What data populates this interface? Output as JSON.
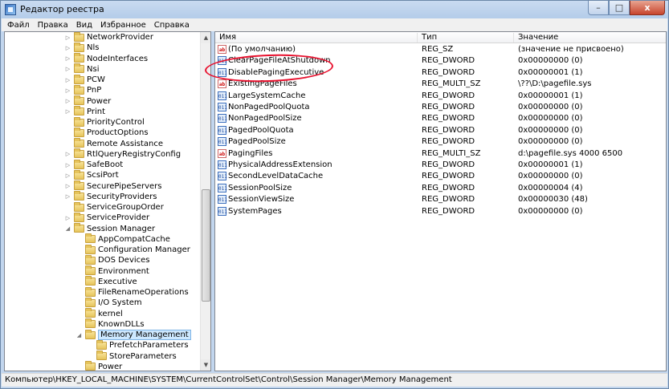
{
  "window": {
    "title": "Редактор реестра",
    "buttons": {
      "minimize": "–",
      "maximize": "□",
      "close": "x"
    }
  },
  "menu": [
    "Файл",
    "Правка",
    "Вид",
    "Избранное",
    "Справка"
  ],
  "tree": {
    "items": [
      {
        "label": "NetworkProvider",
        "level": 1,
        "expander": "▷"
      },
      {
        "label": "Nls",
        "level": 1,
        "expander": "▷"
      },
      {
        "label": "NodeInterfaces",
        "level": 1,
        "expander": "▷"
      },
      {
        "label": "Nsi",
        "level": 1,
        "expander": "▷"
      },
      {
        "label": "PCW",
        "level": 1,
        "expander": "▷"
      },
      {
        "label": "PnP",
        "level": 1,
        "expander": "▷"
      },
      {
        "label": "Power",
        "level": 1,
        "expander": "▷"
      },
      {
        "label": "Print",
        "level": 1,
        "expander": "▷"
      },
      {
        "label": "PriorityControl",
        "level": 1,
        "expander": ""
      },
      {
        "label": "ProductOptions",
        "level": 1,
        "expander": ""
      },
      {
        "label": "Remote Assistance",
        "level": 1,
        "expander": ""
      },
      {
        "label": "RtlQueryRegistryConfig",
        "level": 1,
        "expander": "▷"
      },
      {
        "label": "SafeBoot",
        "level": 1,
        "expander": "▷"
      },
      {
        "label": "ScsiPort",
        "level": 1,
        "expander": "▷"
      },
      {
        "label": "SecurePipeServers",
        "level": 1,
        "expander": "▷"
      },
      {
        "label": "SecurityProviders",
        "level": 1,
        "expander": "▷"
      },
      {
        "label": "ServiceGroupOrder",
        "level": 1,
        "expander": ""
      },
      {
        "label": "ServiceProvider",
        "level": 1,
        "expander": "▷"
      },
      {
        "label": "Session Manager",
        "level": 1,
        "expander": "◢"
      },
      {
        "label": "AppCompatCache",
        "level": 2,
        "expander": ""
      },
      {
        "label": "Configuration Manager",
        "level": 2,
        "expander": ""
      },
      {
        "label": "DOS Devices",
        "level": 2,
        "expander": ""
      },
      {
        "label": "Environment",
        "level": 2,
        "expander": ""
      },
      {
        "label": "Executive",
        "level": 2,
        "expander": ""
      },
      {
        "label": "FileRenameOperations",
        "level": 2,
        "expander": ""
      },
      {
        "label": "I/O System",
        "level": 2,
        "expander": ""
      },
      {
        "label": "kernel",
        "level": 2,
        "expander": ""
      },
      {
        "label": "KnownDLLs",
        "level": 2,
        "expander": ""
      },
      {
        "label": "Memory Management",
        "level": 2,
        "expander": "◢",
        "selected": true
      },
      {
        "label": "PrefetchParameters",
        "level": 3,
        "expander": ""
      },
      {
        "label": "StoreParameters",
        "level": 3,
        "expander": ""
      },
      {
        "label": "Power",
        "level": 2,
        "expander": ""
      }
    ]
  },
  "list": {
    "columns": [
      "Имя",
      "Тип",
      "Значение"
    ],
    "rows": [
      {
        "name": "(По умолчанию)",
        "type": "REG_SZ",
        "value": "(значение не присвоено)",
        "icon": "sz"
      },
      {
        "name": "ClearPageFileAtShutdown",
        "type": "REG_DWORD",
        "value": "0x00000000 (0)",
        "icon": "dword"
      },
      {
        "name": "DisablePagingExecutive",
        "type": "REG_DWORD",
        "value": "0x00000001 (1)",
        "icon": "dword"
      },
      {
        "name": "ExistingPageFiles",
        "type": "REG_MULTI_SZ",
        "value": "\\??\\D:\\pagefile.sys",
        "icon": "sz"
      },
      {
        "name": "LargeSystemCache",
        "type": "REG_DWORD",
        "value": "0x00000001 (1)",
        "icon": "dword"
      },
      {
        "name": "NonPagedPoolQuota",
        "type": "REG_DWORD",
        "value": "0x00000000 (0)",
        "icon": "dword"
      },
      {
        "name": "NonPagedPoolSize",
        "type": "REG_DWORD",
        "value": "0x00000000 (0)",
        "icon": "dword"
      },
      {
        "name": "PagedPoolQuota",
        "type": "REG_DWORD",
        "value": "0x00000000 (0)",
        "icon": "dword"
      },
      {
        "name": "PagedPoolSize",
        "type": "REG_DWORD",
        "value": "0x00000000 (0)",
        "icon": "dword"
      },
      {
        "name": "PagingFiles",
        "type": "REG_MULTI_SZ",
        "value": "d:\\pagefile.sys 4000 6500",
        "icon": "sz"
      },
      {
        "name": "PhysicalAddressExtension",
        "type": "REG_DWORD",
        "value": "0x00000001 (1)",
        "icon": "dword"
      },
      {
        "name": "SecondLevelDataCache",
        "type": "REG_DWORD",
        "value": "0x00000000 (0)",
        "icon": "dword"
      },
      {
        "name": "SessionPoolSize",
        "type": "REG_DWORD",
        "value": "0x00000004 (4)",
        "icon": "dword"
      },
      {
        "name": "SessionViewSize",
        "type": "REG_DWORD",
        "value": "0x00000030 (48)",
        "icon": "dword"
      },
      {
        "name": "SystemPages",
        "type": "REG_DWORD",
        "value": "0x00000000 (0)",
        "icon": "dword"
      }
    ]
  },
  "statusbar": "Компьютер\\HKEY_LOCAL_MACHINE\\SYSTEM\\CurrentControlSet\\Control\\Session Manager\\Memory Management",
  "icons": {
    "sz": "ab",
    "dword": "011"
  },
  "colors": {
    "annotation": "#e8112e",
    "selection": "#cde8ff"
  }
}
